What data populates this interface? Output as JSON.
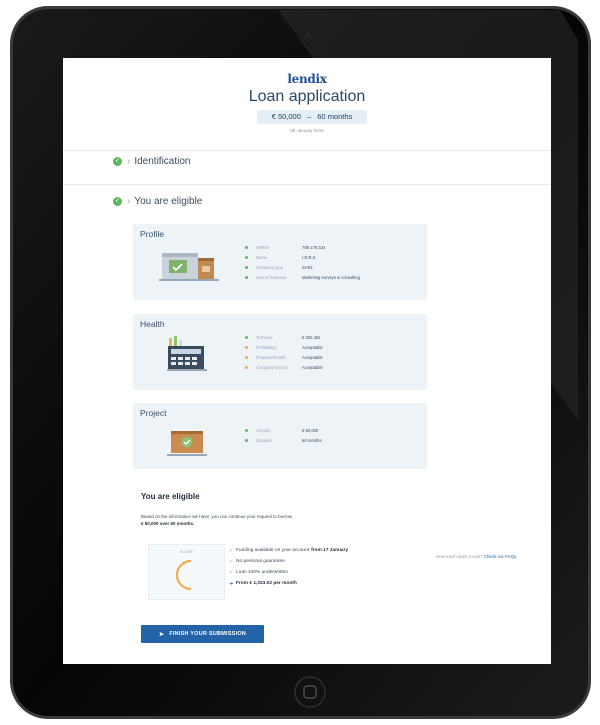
{
  "app": {
    "logo": "lendix"
  },
  "header": {
    "title": "Loan application",
    "amount": "€ 50,000",
    "separator": "–",
    "duration": "60 months",
    "date": "08 January 2018"
  },
  "steps": [
    {
      "label": "Identification"
    },
    {
      "label": "You are eligible"
    }
  ],
  "profile": {
    "title": "Profile",
    "rows": [
      {
        "label": "SIREN",
        "value": "789 178 334"
      },
      {
        "label": "Name",
        "value": "I.D.R.S"
      },
      {
        "label": "Company type",
        "value": "SARL"
      },
      {
        "label": "Line of business",
        "value": "Marketing surveys & consulting"
      }
    ]
  },
  "health": {
    "title": "Health",
    "rows": [
      {
        "label": "Turnover",
        "value": "€ 252,491"
      },
      {
        "label": "Profitability",
        "value": "Acceptable"
      },
      {
        "label": "Financial health",
        "value": "Acceptable"
      },
      {
        "label": "Company history",
        "value": "Acceptable"
      }
    ]
  },
  "project": {
    "title": "Project",
    "rows": [
      {
        "label": "Amount",
        "value": "€ 50,000"
      },
      {
        "label": "Duration",
        "value": "60 months"
      }
    ]
  },
  "eligible": {
    "title": "You are eligible",
    "intro": "Based on the information we have, you can continue your request to borrow",
    "amount_line": "€ 50,000 over 60 months."
  },
  "score": {
    "label": "SCORE"
  },
  "benefits": [
    {
      "text": "Funding available on your account",
      "bold": "from 17 January"
    },
    {
      "text": "No personal guarantee",
      "bold": ""
    },
    {
      "text": "Loan 100% underwritten",
      "bold": ""
    },
    {
      "text": "",
      "bold": "From € 1,023.02 per month"
    }
  ],
  "faq": {
    "question": "How much does it cost?",
    "link": "Check our FAQs."
  },
  "action": {
    "finish_label": "FINISH YOUR SUBMISSION"
  },
  "colors": {
    "success": "#5cb85c",
    "warning": "#f0ad4e",
    "primary": "#2463a7",
    "card_bg": "#eef3f8"
  },
  "icons": {
    "step_check": "check-circle-icon",
    "profile": "storefront-icon",
    "health": "calculator-icon",
    "project": "briefcase-check-icon",
    "finish": "send-icon"
  },
  "status": {
    "profile": [
      "success",
      "success",
      "success",
      "success"
    ],
    "health": [
      "success",
      "warning",
      "warning",
      "warning"
    ],
    "project": [
      "success",
      "success"
    ]
  }
}
